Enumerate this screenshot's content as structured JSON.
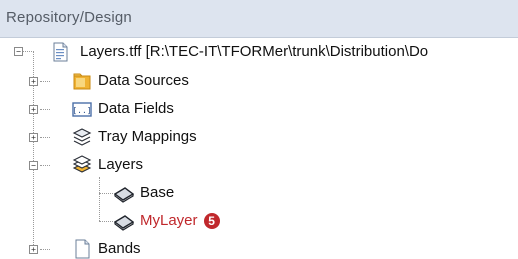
{
  "panel": {
    "title": "Repository/Design"
  },
  "tree": {
    "root": {
      "label": "Layers.tff [R:\\TEC-IT\\TFORMer\\trunk\\Distribution\\Do"
    },
    "items": [
      {
        "label": "Data Sources"
      },
      {
        "label": "Data Fields"
      },
      {
        "label": "Tray Mappings"
      },
      {
        "label": "Layers"
      },
      {
        "label": "Bands"
      }
    ],
    "layers": [
      {
        "label": "Base"
      },
      {
        "label": "MyLayer",
        "badge": "5"
      }
    ]
  },
  "colors": {
    "highlight": "#c0282c",
    "header_bg": "#dde4ef"
  }
}
